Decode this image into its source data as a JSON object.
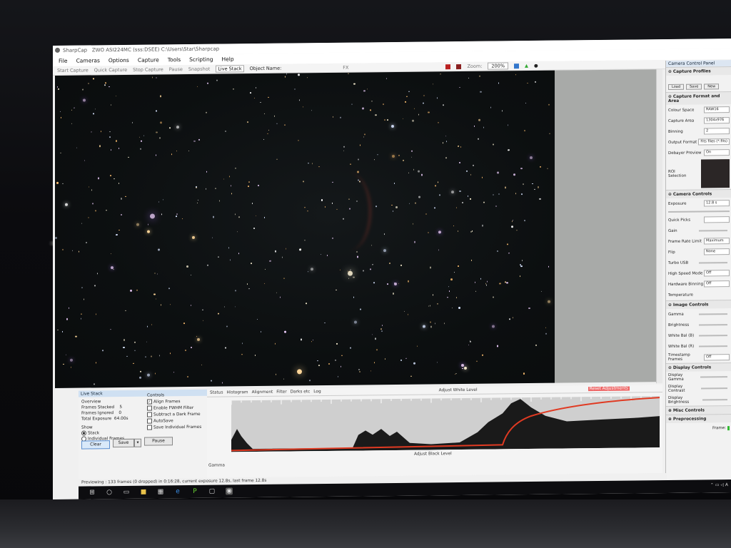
{
  "window": {
    "app_name": "SharpCap",
    "title_rest": "ZWO ASI224MC (sss:DSEE)  C:\\Users\\Star\\Sharpcap"
  },
  "menu": [
    "File",
    "Cameras",
    "Options",
    "Capture",
    "Tools",
    "Scripting",
    "Help"
  ],
  "toolbar": {
    "start_capture": "Start Capture",
    "quick_capture": "Quick Capture",
    "stop_capture": "Stop Capture",
    "pause": "Pause",
    "snapshot": "Snapshot",
    "live_stack": "Live Stack",
    "object_name": "Object Name:",
    "fx": "FX",
    "zoom_label": "Zoom:",
    "zoom_value": "200%"
  },
  "camera_panel": {
    "title": "Camera Control Panel",
    "capture_profiles": "Capture Profiles",
    "profile_buttons": [
      "Load",
      "Save",
      "New"
    ],
    "format_section": "Capture Format and Area",
    "colour_space_label": "Colour Space",
    "colour_space": "RAW16",
    "capture_area_label": "Capture Area",
    "capture_area": "1304x976",
    "binning_label": "Binning",
    "binning": "2",
    "output_format_label": "Output Format",
    "output_format": "Fits files (*.fits)",
    "debayer_label": "Debayer Preview",
    "debayer": "On",
    "roi_label": "ROI Selection",
    "camera_controls": "Camera Controls",
    "exposure_label": "Exposure",
    "exposure": "12.8 s",
    "quick_picks": "Quick Picks",
    "gain_label": "Gain",
    "frame_rate_label": "Frame Rate Limit",
    "frame_rate": "Maximum",
    "flip_label": "Flip",
    "flip": "None",
    "turbo_label": "Turbo USB",
    "high_speed_label": "High Speed Mode",
    "high_speed": "Off",
    "hw_binning_label": "Hardware Binning",
    "hw_binning": "Off",
    "temperature_label": "Temperature",
    "image_controls": "Image Controls",
    "gamma_label": "Gamma",
    "brightness_label": "Brightness",
    "wb_b_label": "White Bal (B)",
    "wb_r_label": "White Bal (R)",
    "timestamp_label": "Timestamp Frames",
    "timestamp": "Off",
    "display_controls": "Display Controls",
    "display_gamma_label": "Display Gamma",
    "display_contrast_label": "Display Contrast",
    "display_brightness_label": "Display Brightness",
    "misc_controls": "Misc Controls",
    "preprocessing": "Preprocessing",
    "frame_label": "Frame:"
  },
  "live_stack": {
    "title": "Live Stack",
    "overview": "Overview",
    "frames_stacked_label": "Frames Stacked",
    "frames_stacked": "5",
    "frames_ignored_label": "Frames Ignored",
    "frames_ignored": "0",
    "total_exposure_label": "Total Exposure",
    "total_exposure": "64.00s",
    "show_label": "Show",
    "show_stack": "Stack",
    "show_individual": "Individual Frames",
    "controls_label": "Controls",
    "align_frames": "Align Frames",
    "enable_fwhm": "Enable FWHM Filter",
    "subtract_dark": "Subtract a Dark Frame",
    "autosave": "AutoSave",
    "save_individual": "Save Individual Frames",
    "clear": "Clear",
    "save": "Save",
    "pause": "Pause"
  },
  "histogram": {
    "tabs": [
      "Status",
      "Histogram",
      "Alignment",
      "Filter",
      "Darks etc",
      "Log"
    ],
    "white_level": "Adjust White Level",
    "black_level": "Adjust Black Level",
    "reset": "Reset Adjustments",
    "gamma": "Gamma"
  },
  "status": "Previewing : 133 frames (0 dropped) in 0:16:28, current exposure 12.8s, last frame 12.8s",
  "colors": {
    "curve": "#e03a22",
    "sky": "#0c0f10",
    "panel": "#f2f2f2"
  }
}
